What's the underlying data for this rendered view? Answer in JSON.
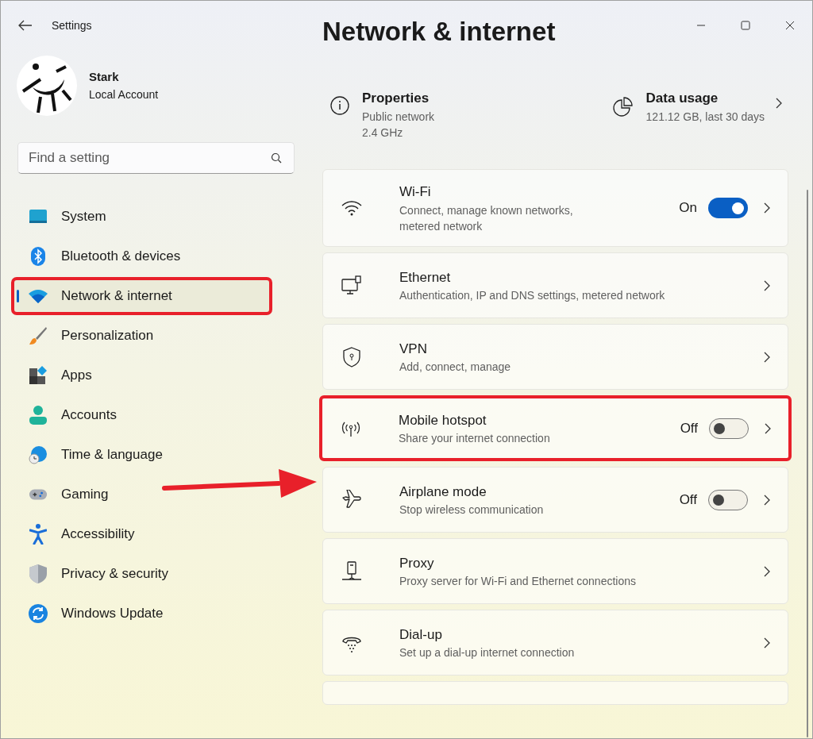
{
  "window": {
    "title": "Settings"
  },
  "account": {
    "name": "Stark",
    "type": "Local Account"
  },
  "search": {
    "placeholder": "Find a setting"
  },
  "sidebar": {
    "items": [
      {
        "label": "System",
        "selected": false,
        "highlighted": false
      },
      {
        "label": "Bluetooth & devices",
        "selected": false,
        "highlighted": false
      },
      {
        "label": "Network & internet",
        "selected": true,
        "highlighted": true
      },
      {
        "label": "Personalization",
        "selected": false,
        "highlighted": false
      },
      {
        "label": "Apps",
        "selected": false,
        "highlighted": false
      },
      {
        "label": "Accounts",
        "selected": false,
        "highlighted": false
      },
      {
        "label": "Time & language",
        "selected": false,
        "highlighted": false
      },
      {
        "label": "Gaming",
        "selected": false,
        "highlighted": false
      },
      {
        "label": "Accessibility",
        "selected": false,
        "highlighted": false
      },
      {
        "label": "Privacy & security",
        "selected": false,
        "highlighted": false
      },
      {
        "label": "Windows Update",
        "selected": false,
        "highlighted": false
      }
    ]
  },
  "page_title": "Network & internet",
  "summary": [
    {
      "title": "Properties",
      "lines": [
        "Public network",
        "2.4 GHz"
      ],
      "chevron": false
    },
    {
      "title": "Data usage",
      "lines": [
        "121.12 GB, last 30 days"
      ],
      "chevron": true
    }
  ],
  "cards": [
    {
      "kind": "toggle",
      "title": "Wi-Fi",
      "description": "Connect, manage known networks,\nmetered network",
      "state_label": "On",
      "on": true,
      "highlighted": false
    },
    {
      "kind": "link",
      "title": "Ethernet",
      "description": "Authentication, IP and DNS settings, metered network",
      "highlighted": false
    },
    {
      "kind": "link",
      "title": "VPN",
      "description": "Add, connect, manage",
      "highlighted": false
    },
    {
      "kind": "toggle",
      "title": "Mobile hotspot",
      "description": "Share your internet connection",
      "state_label": "Off",
      "on": false,
      "highlighted": true
    },
    {
      "kind": "toggle",
      "title": "Airplane mode",
      "description": "Stop wireless communication",
      "state_label": "Off",
      "on": false,
      "highlighted": false
    },
    {
      "kind": "link",
      "title": "Proxy",
      "description": "Proxy server for Wi-Fi and Ethernet connections",
      "highlighted": false
    },
    {
      "kind": "link",
      "title": "Dial-up",
      "description": "Set up a dial-up internet connection",
      "highlighted": false
    }
  ]
}
